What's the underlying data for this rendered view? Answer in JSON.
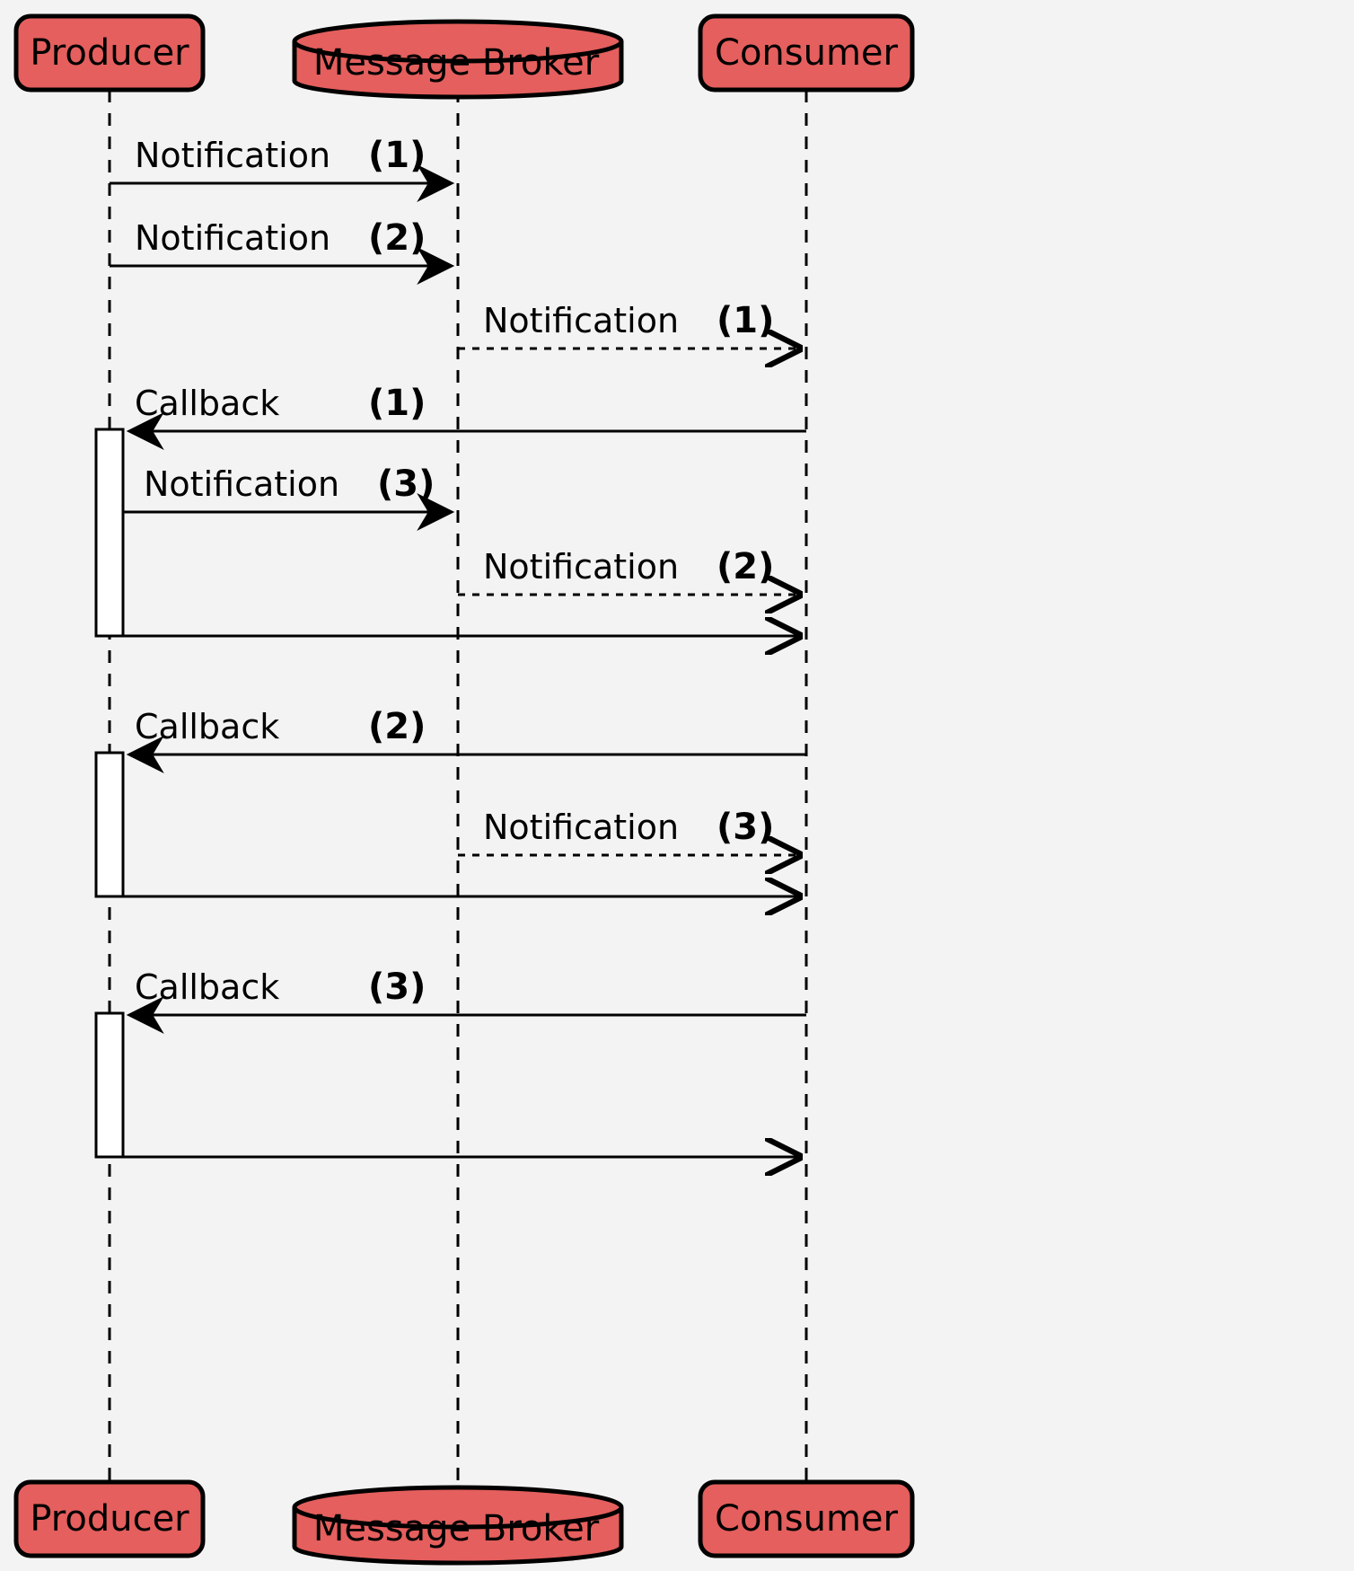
{
  "participants": {
    "producer": "Producer",
    "broker": "Message Broker",
    "consumer": "Consumer"
  },
  "messages": {
    "m1": {
      "label": "Notification",
      "num": "(1)"
    },
    "m2": {
      "label": "Notification",
      "num": "(2)"
    },
    "m3": {
      "label": "Notification",
      "num": "(1)"
    },
    "m4": {
      "label": "Callback",
      "num": "(1)"
    },
    "m5": {
      "label": "Notification",
      "num": "(3)"
    },
    "m6": {
      "label": "Notification",
      "num": "(2)"
    },
    "m7": {
      "label": "Callback",
      "num": "(2)"
    },
    "m8": {
      "label": "Notification",
      "num": "(3)"
    },
    "m9": {
      "label": "Callback",
      "num": "(3)"
    }
  }
}
